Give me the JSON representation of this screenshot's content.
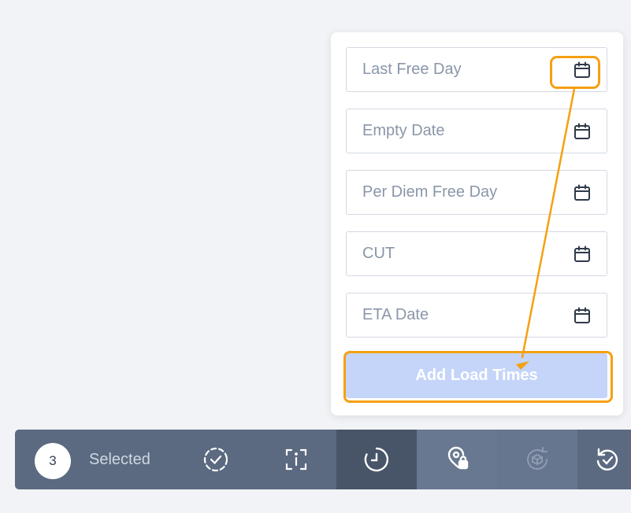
{
  "form": {
    "fields": [
      {
        "placeholder": "Last Free Day",
        "icon": "calendar-icon"
      },
      {
        "placeholder": "Empty Date",
        "icon": "calendar-icon"
      },
      {
        "placeholder": "Per Diem Free Day",
        "icon": "calendar-icon"
      },
      {
        "placeholder": "CUT",
        "icon": "calendar-icon"
      },
      {
        "placeholder": "ETA Date",
        "icon": "calendar-icon"
      }
    ],
    "submit_label": "Add Load Times"
  },
  "toolbar": {
    "count": "3",
    "selected_label": "Selected",
    "buttons": [
      {
        "icon": "check-circle-dashed-icon"
      },
      {
        "icon": "scan-info-icon"
      },
      {
        "icon": "clock-icon"
      },
      {
        "icon": "location-lock-icon"
      },
      {
        "icon": "package-refresh-icon"
      },
      {
        "icon": "rotate-check-icon"
      }
    ]
  },
  "colors": {
    "highlight": "#f5a012",
    "button_disabled": "#c4d5f9",
    "toolbar_bg": "#5b6a80",
    "toolbar_active": "#485569"
  }
}
